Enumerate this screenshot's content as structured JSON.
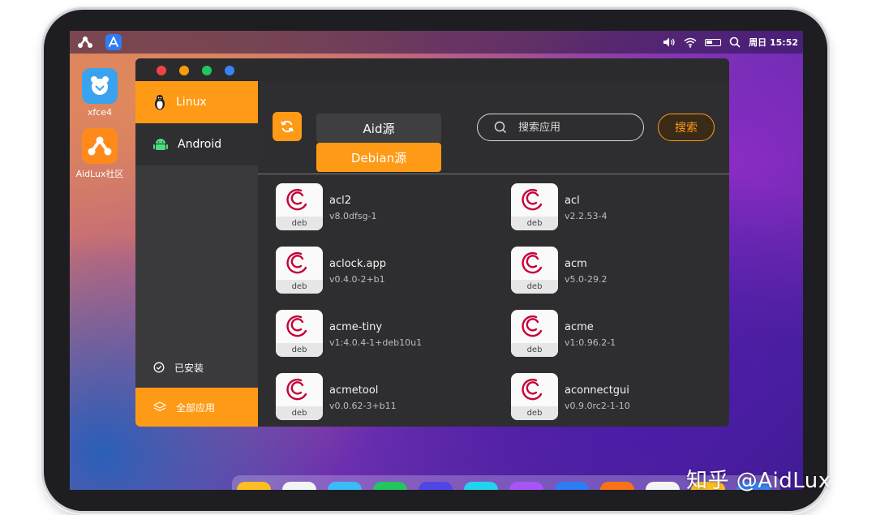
{
  "topbar": {
    "datetime": "周日 15:52"
  },
  "desktop_icons": [
    {
      "label": "xfce4"
    },
    {
      "label": "AidLux社区"
    }
  ],
  "sidebar": {
    "items": [
      {
        "label": "Linux"
      },
      {
        "label": "Android"
      }
    ],
    "installed_label": "已安装",
    "all_apps_label": "全部应用"
  },
  "sources": {
    "aid": "Aid源",
    "debian": "Debian源"
  },
  "search": {
    "placeholder": "搜索应用",
    "button_label": "搜索"
  },
  "packages": [
    {
      "name": "acl2",
      "version": "v8.0dfsg-1",
      "badge": "deb"
    },
    {
      "name": "acl",
      "version": "v2.2.53-4",
      "badge": "deb"
    },
    {
      "name": "aclock.app",
      "version": "v0.4.0-2+b1",
      "badge": "deb"
    },
    {
      "name": "acm",
      "version": "v5.0-29.2",
      "badge": "deb"
    },
    {
      "name": "acme-tiny",
      "version": "v1:4.0.4-1+deb10u1",
      "badge": "deb"
    },
    {
      "name": "acme",
      "version": "v1:0.96.2-1",
      "badge": "deb"
    },
    {
      "name": "acmetool",
      "version": "v0.0.62-3+b11",
      "badge": "deb"
    },
    {
      "name": "aconnectgui",
      "version": "v0.9.0rc2-1-10",
      "badge": "deb"
    }
  ],
  "watermark": "知乎 @AidLux",
  "colors": {
    "accent": "#fe9a16",
    "debian_red": "#c70036",
    "store_blue": "#2f7df6"
  }
}
